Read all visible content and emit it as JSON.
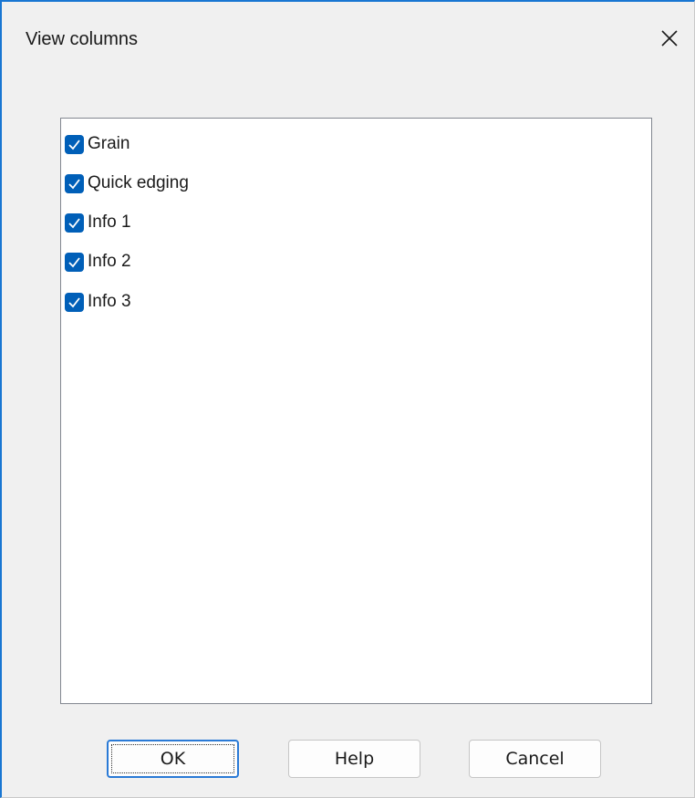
{
  "window": {
    "title": "View columns",
    "accent_color": "#1976d2"
  },
  "titlebar": {
    "close_icon": "close-icon"
  },
  "columns": {
    "items": [
      {
        "label": "Grain",
        "checked": true
      },
      {
        "label": "Quick edging",
        "checked": true
      },
      {
        "label": "Info 1",
        "checked": true
      },
      {
        "label": "Info 2",
        "checked": true
      },
      {
        "label": "Info 3",
        "checked": true
      }
    ],
    "checkbox_color": "#005fb8"
  },
  "buttons": {
    "ok_label": "OK",
    "help_label": "Help",
    "cancel_label": "Cancel"
  }
}
